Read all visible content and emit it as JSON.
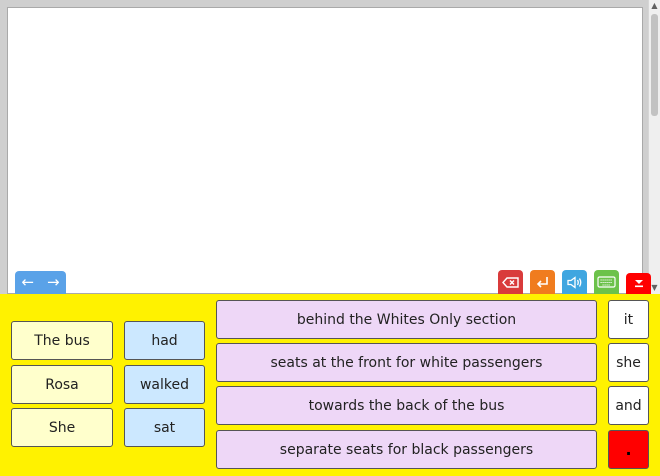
{
  "nav": {
    "back": "←",
    "forward": "→"
  },
  "subjects": [
    "The bus",
    "Rosa",
    "She"
  ],
  "verbs": [
    "had",
    "walked",
    "sat"
  ],
  "phrases": [
    "behind the Whites Only section",
    "seats at the front for white passengers",
    "towards the back of the bus",
    "separate seats for black passengers"
  ],
  "connectives": [
    "it",
    "she",
    "and"
  ],
  "punctuation": ".",
  "colors": {
    "panel": "#fff200",
    "nav": "#5aa2e8",
    "delete": "#d93b3b",
    "enter": "#f07c1e",
    "speak": "#3fa6e0",
    "keyboard": "#6cc24a",
    "hide": "#ff0000"
  },
  "icons": {
    "delete": "backspace-icon",
    "enter": "enter-icon",
    "speak": "speaker-icon",
    "keyboard": "keyboard-icon",
    "hide": "hide-panel-icon"
  }
}
